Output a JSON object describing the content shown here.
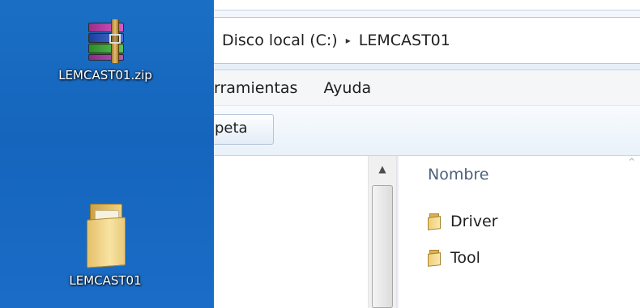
{
  "desktop": {
    "icons": [
      {
        "label": "LEMCAST01.zip",
        "icon": "winrar-archive-icon"
      },
      {
        "label": "LEMCAST01",
        "icon": "folder-icon"
      }
    ]
  },
  "explorer": {
    "breadcrumb": {
      "items": [
        "Disco local (C:)",
        "LEMCAST01"
      ],
      "separator": "▸"
    },
    "menu": {
      "items": [
        "rramientas",
        "Ayuda"
      ]
    },
    "toolbar": {
      "partial_button_label": "peta"
    },
    "nav_pane": {
      "scroll_up_glyph": "▲"
    },
    "file_list": {
      "column_header": "Nombre",
      "sort_glyph": "^",
      "items": [
        {
          "name": "Driver",
          "icon": "folder-icon"
        },
        {
          "name": "Tool",
          "icon": "folder-icon"
        }
      ]
    }
  },
  "colors": {
    "desktop_blue": "#1565bd",
    "header_text": "#4c607a"
  }
}
